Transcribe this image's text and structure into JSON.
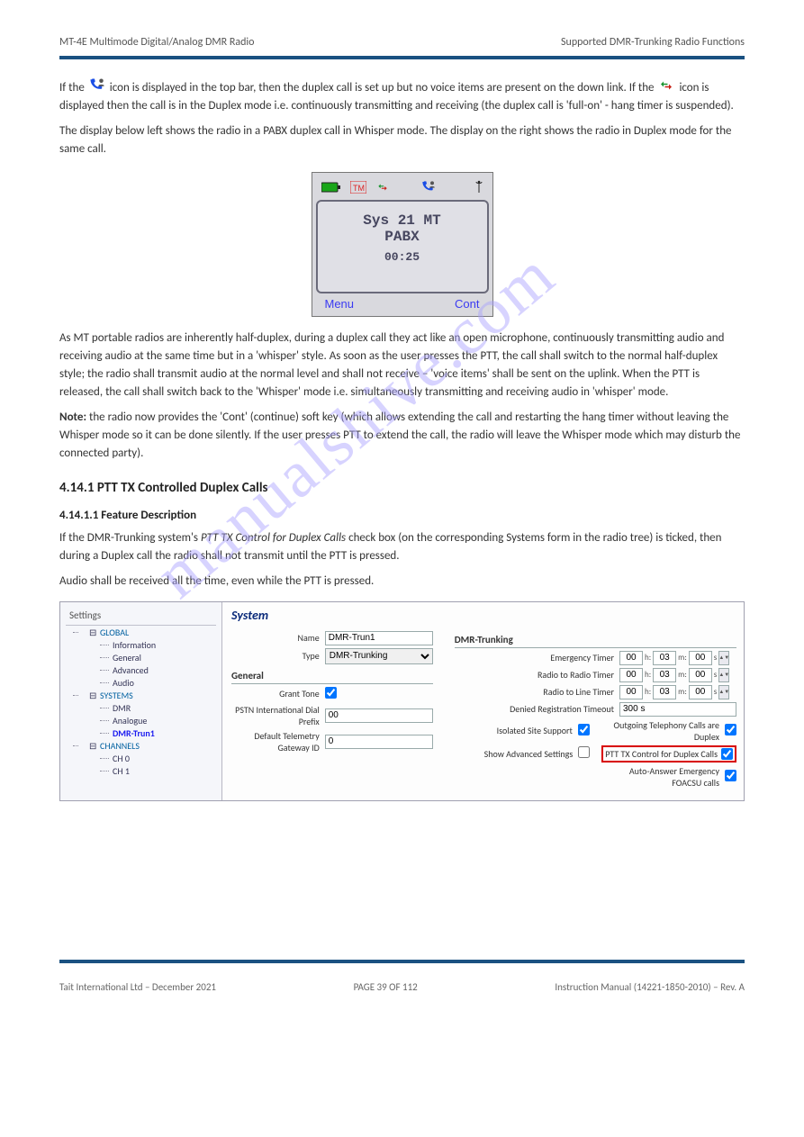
{
  "header": {
    "left": "MT-4E Multimode Digital/Analog DMR Radio",
    "right": "Supported DMR-Trunking Radio Functions"
  },
  "intro": {
    "p1_pre": "If the",
    "p1_mid": "icon is displayed in the top bar, then the duplex call is set up but no voice items are present on the down link. If the",
    "p1_mid2": "icon is displayed then the call is in the Duplex mode i.e. continuously transmitting and receiving (the duplex call is 'full-on' - hang timer is suspended).",
    "p2": "The display below left shows the radio in a PABX duplex call in Whisper mode. The display on the right shows the radio in Duplex mode for the same call."
  },
  "radio": {
    "line1": "Sys 21 MT",
    "line2": "PABX",
    "time": "00:25",
    "soft_left": "Menu",
    "soft_right": "Cont"
  },
  "whisper": {
    "p1": "As MT portable radios are inherently half-duplex, during a duplex call they act like an open microphone, continuously transmitting audio and receiving audio at the same time but in a 'whisper' style. As soon as the user presses the PTT, the call shall switch to the normal half-duplex style; the radio shall transmit audio at the normal level and shall not receive – 'voice items' shall be sent on the uplink. When the PTT is released, the call shall switch back to the 'Whisper' mode i.e. simultaneously transmitting and receiving audio in 'whisper' mode.",
    "note_pre": "Note:",
    "note": "the radio now provides the 'Cont' (continue) soft key (which allows extending the call and restarting the hang timer without leaving the Whisper mode so it can be done silently. If the user presses PTT to extend the call, the radio will leave the Whisper mode which may disturb the connected party)."
  },
  "section": "4.14.1 PTT TX Controlled Duplex Calls",
  "sub2": "4.14.1.1 Feature Description",
  "ptt": {
    "p1_pre": "If the DMR-Trunking system's",
    "p1_ital": "PTT TX Control for Duplex Calls",
    "p1_post": "check box (on the corresponding Systems form in the radio tree) is ticked, then during a Duplex call the radio shall not transmit until the PTT is pressed.",
    "p2": "Audio shall be received all the time, even while the PTT is pressed."
  },
  "settings": {
    "panel_title": "Settings",
    "tree": {
      "global": "GLOBAL",
      "global_items": [
        "Information",
        "General",
        "Advanced",
        "Audio"
      ],
      "systems": "SYSTEMS",
      "systems_items": [
        "DMR",
        "Analogue",
        "DMR-Trun1"
      ],
      "channels": "CHANNELS",
      "channel_items": [
        "CH 0",
        "CH 1"
      ]
    },
    "form": {
      "title": "System",
      "name_lbl": "Name",
      "name_val": "DMR-Trun1",
      "type_lbl": "Type",
      "type_val": "DMR-Trunking",
      "general_lbl": "General",
      "grant_lbl": "Grant Tone",
      "pstn_lbl": "PSTN International Dial Prefix",
      "pstn_val": "00",
      "telemetry_lbl": "Default Telemetry Gateway ID",
      "telemetry_val": "0",
      "trunk_lbl": "DMR-Trunking",
      "emer_lbl": "Emergency Timer",
      "r2r_lbl": "Radio to Radio Timer",
      "r2l_lbl": "Radio to Line Timer",
      "denied_lbl": "Denied Registration Timeout",
      "denied_val": "300 s",
      "iso_lbl": "Isolated Site Support",
      "adv_lbl": "Show Advanced Settings",
      "out_lbl": "Outgoing Telephony Calls are Duplex",
      "ptt_lbl": "PTT TX Control for Duplex Calls",
      "auto_lbl": "Auto-Answer Emergency FOACSU calls",
      "time_vals": {
        "h": "00",
        "m": "03",
        "s": "00"
      }
    }
  },
  "footer": {
    "left": "Tait International Ltd – December 2021",
    "center": "PAGE 39 OF 112",
    "right": "Instruction Manual (14221-1850-2010) – Rev. A"
  },
  "watermark": "manualshive.com"
}
